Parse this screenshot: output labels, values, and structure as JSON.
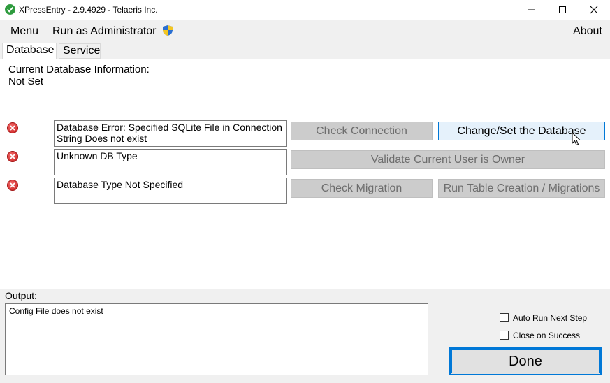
{
  "window": {
    "title": "XPressEntry - 2.9.4929 - Telaeris Inc.",
    "minimize_icon": "minimize-icon",
    "maximize_icon": "maximize-icon",
    "close_icon": "close-icon"
  },
  "menu": {
    "items": [
      {
        "label": "Menu"
      },
      {
        "label": "Run as Administrator"
      }
    ],
    "about": "About"
  },
  "tabs": [
    {
      "label": "Database",
      "selected": true
    },
    {
      "label": "Service",
      "selected": false
    }
  ],
  "database_info": {
    "label": "Current Database Information:",
    "value": "Not Set"
  },
  "checks": [
    {
      "status": "error",
      "message": "Database Error: Specified SQLite File in Connection String Does not exist"
    },
    {
      "status": "error",
      "message": "Unknown DB Type"
    },
    {
      "status": "error",
      "message": "Database Type Not Specified"
    }
  ],
  "buttons": {
    "check_connection": "Check Connection",
    "change_database": "Change/Set the Database",
    "validate_owner": "Validate Current User is Owner",
    "check_migration": "Check Migration",
    "run_migrations": "Run Table Creation / Migrations",
    "done": "Done"
  },
  "output": {
    "label": "Output:",
    "text": "Config File does not exist"
  },
  "options": {
    "auto_run": {
      "label": "Auto Run Next Step",
      "checked": false
    },
    "close_on_success": {
      "label": "Close on Success",
      "checked": false
    }
  },
  "colors": {
    "accent": "#0078d7",
    "error": "#c81d1d",
    "disabled_button": "#cccccc"
  }
}
